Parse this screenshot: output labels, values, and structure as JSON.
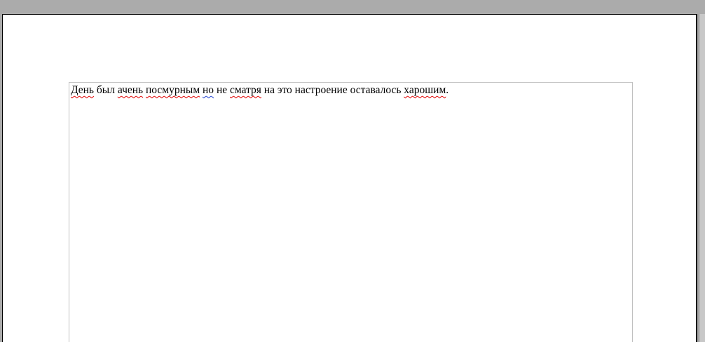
{
  "document": {
    "paragraph": {
      "words": [
        {
          "text": "День",
          "mark": "spell"
        },
        {
          "text": " был ",
          "mark": "none"
        },
        {
          "text": "ачень",
          "mark": "spell"
        },
        {
          "text": " ",
          "mark": "none"
        },
        {
          "text": "посмурным",
          "mark": "spell"
        },
        {
          "text": " ",
          "mark": "none"
        },
        {
          "text": "но",
          "mark": "grammar"
        },
        {
          "text": " не ",
          "mark": "none"
        },
        {
          "text": "сматря",
          "mark": "spell"
        },
        {
          "text": " на это настроение оставалось ",
          "mark": "none"
        },
        {
          "text": "харошим",
          "mark": "spell"
        },
        {
          "text": ".",
          "mark": "none"
        }
      ]
    }
  },
  "colors": {
    "workspace_background": "#ababab",
    "page_background": "#ffffff",
    "text_boundary": "#c0c0c0",
    "spelling_error_underline": "#e00000",
    "grammar_error_underline": "#2040d0"
  }
}
